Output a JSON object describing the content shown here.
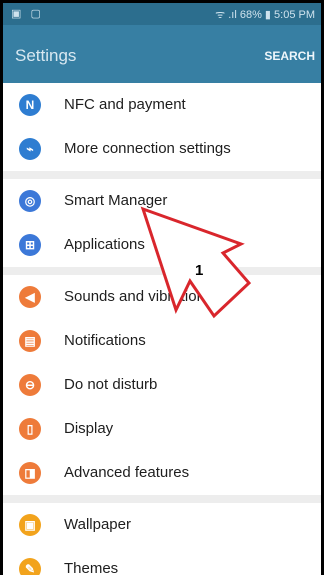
{
  "status_bar": {
    "right_text": "ᯤ .ıl 68% ▮ 5:05 PM"
  },
  "app_bar": {
    "title": "Settings",
    "action": "SEARCH"
  },
  "groups": [
    [
      {
        "label": "NFC and payment",
        "icon": "nfc-icon",
        "color": "#2e7dd1",
        "glyph": "N"
      },
      {
        "label": "More connection settings",
        "icon": "wireless-icon",
        "color": "#2e7dd1",
        "glyph": "⌁"
      }
    ],
    [
      {
        "label": "Smart Manager",
        "icon": "smart-manager-icon",
        "color": "#3c78d8",
        "glyph": "◎"
      },
      {
        "label": "Applications",
        "icon": "applications-icon",
        "color": "#3c78d8",
        "glyph": "⊞"
      }
    ],
    [
      {
        "label": "Sounds and vibration",
        "icon": "sound-icon",
        "color": "#ee7b3a",
        "glyph": "◀"
      },
      {
        "label": "Notifications",
        "icon": "notifications-icon",
        "color": "#ee7b3a",
        "glyph": "▤"
      },
      {
        "label": "Do not disturb",
        "icon": "do-not-disturb-icon",
        "color": "#ee7b3a",
        "glyph": "⊖"
      },
      {
        "label": "Display",
        "icon": "display-icon",
        "color": "#ee7b3a",
        "glyph": "▯"
      },
      {
        "label": "Advanced features",
        "icon": "advanced-features-icon",
        "color": "#ee7b3a",
        "glyph": "◨"
      }
    ],
    [
      {
        "label": "Wallpaper",
        "icon": "wallpaper-icon",
        "color": "#f2a31c",
        "glyph": "▣"
      },
      {
        "label": "Themes",
        "icon": "themes-icon",
        "color": "#f2a31c",
        "glyph": "✎"
      }
    ]
  ],
  "annotation": {
    "label": "1"
  }
}
